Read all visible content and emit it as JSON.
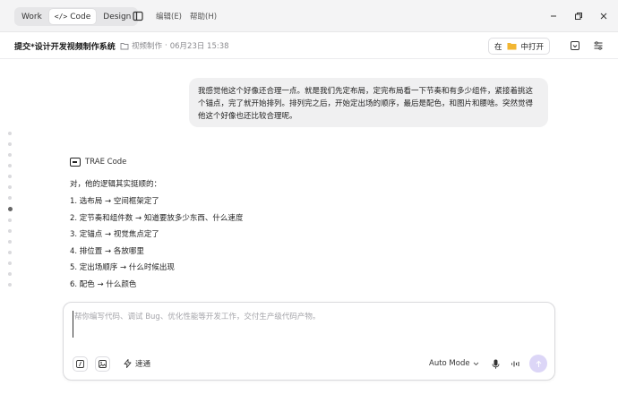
{
  "titlebar": {
    "modes": [
      {
        "label": "Work",
        "active": false
      },
      {
        "label": "Code",
        "active": true
      },
      {
        "label": "Design",
        "active": false
      }
    ],
    "code_glyph": "</>",
    "menus": [
      "编辑(E)",
      "帮助(H)"
    ]
  },
  "header": {
    "title": "提交*设计开发视频制作系统",
    "project": "视频制作",
    "separator": "·",
    "date": "06月23日 15:38",
    "open_in_label": "在",
    "open_in_target": "中打开"
  },
  "chat": {
    "user_message": "我感觉他这个好像还合理一点。就是我们先定布局，定完布局看一下节奏和有多少组件，紧接着挑这个锚点，完了就开始排列。排列完之后，开始定出场的顺序，最后是配色，和图片和腰啥。突然觉得他这个好像也还比较合理呢。",
    "agent_name": "TRAE Code",
    "answer_intro": "对，他的逻辑其实挺顺的：",
    "steps": [
      "1. 选布局 → 空间框架定了",
      "2. 定节奏和组件数 → 知道要放多少东西、什么速度",
      "3. 定锚点 → 视觉焦点定了",
      "4. 排位置 → 各放哪里",
      "5. 定出场顺序 → 什么时候出现",
      "6. 配色 → 什么颜色"
    ]
  },
  "composer": {
    "placeholder": "帮你编写代码、调试 Bug、优化性能等开发工作，交付生产级代码产物。",
    "think_label": "速通",
    "mode_label": "Auto Mode"
  },
  "colors": {
    "accent": "#dcd6f7",
    "titlebar_bg": "#f4f4f5",
    "bubble_bg": "#f0f0f1",
    "folder": "#f2b632"
  }
}
